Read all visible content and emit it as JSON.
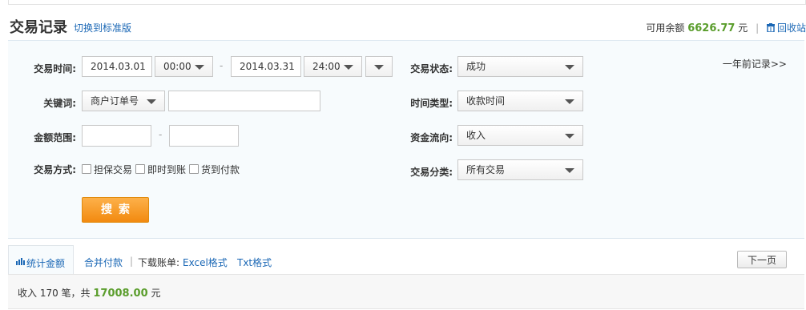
{
  "header": {
    "title": "交易记录",
    "switch_link": "切换到标准版",
    "balance_label": "可用余额",
    "balance_amount": "6626.77",
    "balance_unit": "元",
    "recycle_label": "回收站"
  },
  "filters": {
    "trade_time_label": "交易时间:",
    "start_date": "2014.03.01",
    "start_time": "00:00",
    "end_date": "2014.03.31",
    "end_time": "24:00",
    "keyword_label": "关键词:",
    "keyword_type": "商户订单号",
    "keyword_value": "",
    "amount_label": "金额范围:",
    "amount_min": "",
    "amount_max": "",
    "method_label": "交易方式:",
    "methods": [
      "担保交易",
      "即时到账",
      "货到付款"
    ],
    "status_label": "交易状态:",
    "status_value": "成功",
    "time_type_label": "时间类型:",
    "time_type_value": "收款时间",
    "flow_label": "资金流向:",
    "flow_value": "收入",
    "category_label": "交易分类:",
    "category_value": "所有交易",
    "older_records": "一年前记录>>",
    "search_button": "搜索",
    "dash": "-"
  },
  "tabs": {
    "stats": "统计金额",
    "merge_pay": "合并付款",
    "download_label": "下载账单:",
    "excel": "Excel格式",
    "txt": "Txt格式",
    "next_page": "下一页"
  },
  "summary": {
    "prefix": "收入 170 笔，共",
    "amount": "17008.00",
    "unit": "元"
  },
  "colors": {
    "link": "#1a67b5",
    "amount_green": "#5a9d2c",
    "search_orange": "#f28a10"
  }
}
